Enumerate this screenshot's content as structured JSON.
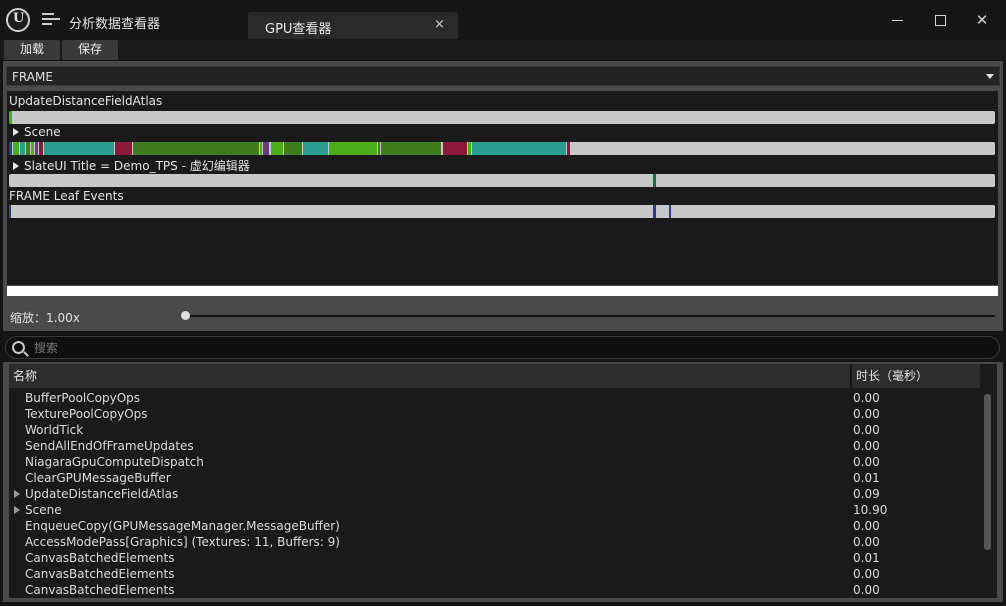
{
  "app": {
    "title": "分析数据查看器",
    "tab_label": "GPU查看器",
    "tab_close": "×"
  },
  "window_controls": {
    "close": "✕"
  },
  "toolbar": {
    "load_label": "加载",
    "save_label": "保存"
  },
  "frame_dropdown": {
    "value": "FRAME"
  },
  "timeline": {
    "rows": [
      {
        "label": "UpdateDistanceFieldAtlas",
        "expandable": false
      },
      {
        "label": "Scene",
        "expandable": true
      },
      {
        "label": "SlateUI Title = Demo_TPS - 虚幻编辑器",
        "expandable": true
      },
      {
        "label": "FRAME Leaf Events",
        "expandable": false
      }
    ]
  },
  "zoom": {
    "label": "缩放：1.00x"
  },
  "search": {
    "placeholder": "搜索",
    "value": ""
  },
  "table": {
    "columns": [
      "名称",
      "时长（毫秒）"
    ],
    "rows": [
      {
        "name": "BufferPoolCopyOps",
        "duration": "0.00",
        "expandable": false
      },
      {
        "name": "TexturePoolCopyOps",
        "duration": "0.00",
        "expandable": false
      },
      {
        "name": "WorldTick",
        "duration": "0.00",
        "expandable": false
      },
      {
        "name": "SendAllEndOfFrameUpdates",
        "duration": "0.00",
        "expandable": false
      },
      {
        "name": "NiagaraGpuComputeDispatch",
        "duration": "0.00",
        "expandable": false
      },
      {
        "name": "ClearGPUMessageBuffer",
        "duration": "0.01",
        "expandable": false
      },
      {
        "name": "UpdateDistanceFieldAtlas",
        "duration": "0.09",
        "expandable": true
      },
      {
        "name": "Scene",
        "duration": "10.90",
        "expandable": true
      },
      {
        "name": "EnqueueCopy(GPUMessageManager.MessageBuffer)",
        "duration": "0.00",
        "expandable": false
      },
      {
        "name": "AccessModePass[Graphics] (Textures: 11, Buffers: 9)",
        "duration": "0.00",
        "expandable": false
      },
      {
        "name": "CanvasBatchedElements",
        "duration": "0.01",
        "expandable": false
      },
      {
        "name": "CanvasBatchedElements",
        "duration": "0.00",
        "expandable": false
      },
      {
        "name": "CanvasBatchedElements",
        "duration": "0.00",
        "expandable": false
      }
    ]
  },
  "colors": {
    "teal": "#2a9d8f",
    "green": "#4caf1a",
    "dark_green": "#3f7d1e",
    "crimson": "#8b1a3a",
    "purple": "#6a3a8a",
    "navy": "#2b3f8a",
    "bar_bg": "#c8c8c8"
  }
}
